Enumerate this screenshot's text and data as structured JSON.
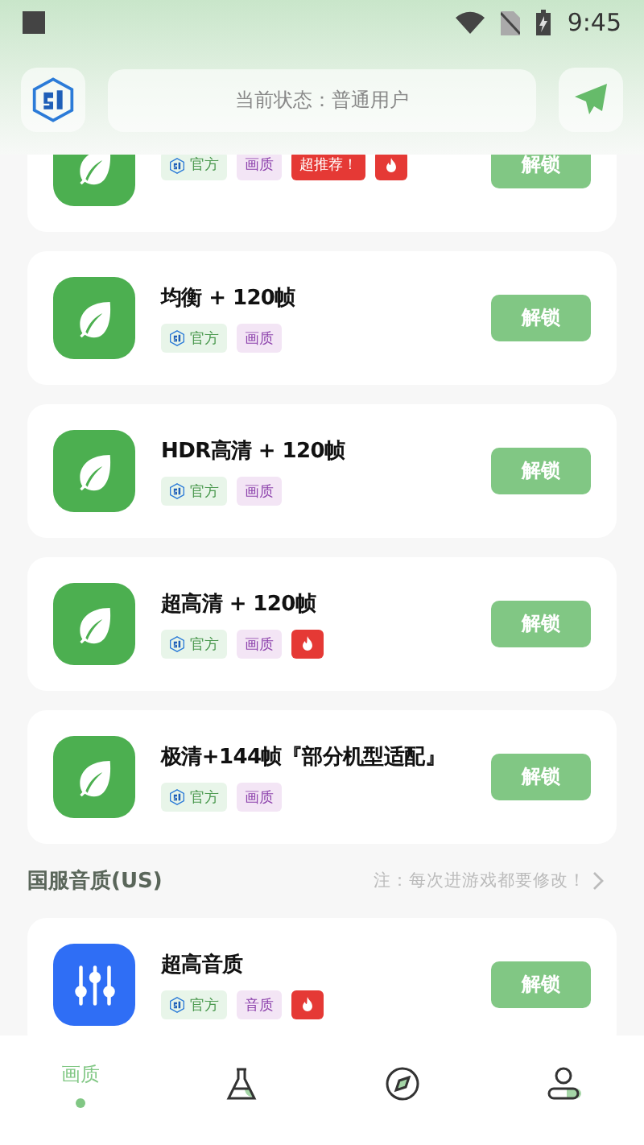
{
  "status_bar": {
    "time": "9:45"
  },
  "header": {
    "status_text": "当前状态：普通用户"
  },
  "cards": [
    {
      "tags": [
        {
          "kind": "official",
          "label": "官方"
        },
        {
          "kind": "category",
          "label": "画质"
        },
        {
          "kind": "recommend",
          "label": "超推荐！"
        },
        {
          "kind": "hot"
        }
      ],
      "button": "解锁"
    },
    {
      "title": "均衡 + 120帧",
      "tags": [
        {
          "kind": "official",
          "label": "官方"
        },
        {
          "kind": "category",
          "label": "画质"
        }
      ],
      "button": "解锁"
    },
    {
      "title": "HDR高清 + 120帧",
      "tags": [
        {
          "kind": "official",
          "label": "官方"
        },
        {
          "kind": "category",
          "label": "画质"
        }
      ],
      "button": "解锁"
    },
    {
      "title": "超高清 + 120帧",
      "tags": [
        {
          "kind": "official",
          "label": "官方"
        },
        {
          "kind": "category",
          "label": "画质"
        },
        {
          "kind": "hot"
        }
      ],
      "button": "解锁"
    },
    {
      "title": "极清+144帧『部分机型适配』",
      "tags": [
        {
          "kind": "official",
          "label": "官方"
        },
        {
          "kind": "category",
          "label": "画质"
        }
      ],
      "button": "解锁"
    }
  ],
  "section": {
    "title": "国服音质(US)",
    "note": "注：每次进游戏都要修改！"
  },
  "section_cards": [
    {
      "title": "超高音质",
      "tags": [
        {
          "kind": "official",
          "label": "官方"
        },
        {
          "kind": "category",
          "label": "音质"
        },
        {
          "kind": "hot"
        }
      ],
      "button": "解锁"
    }
  ],
  "tabs": [
    {
      "label": "画质",
      "selected": true
    },
    {
      "selected": false
    },
    {
      "selected": false
    },
    {
      "selected": false
    }
  ]
}
